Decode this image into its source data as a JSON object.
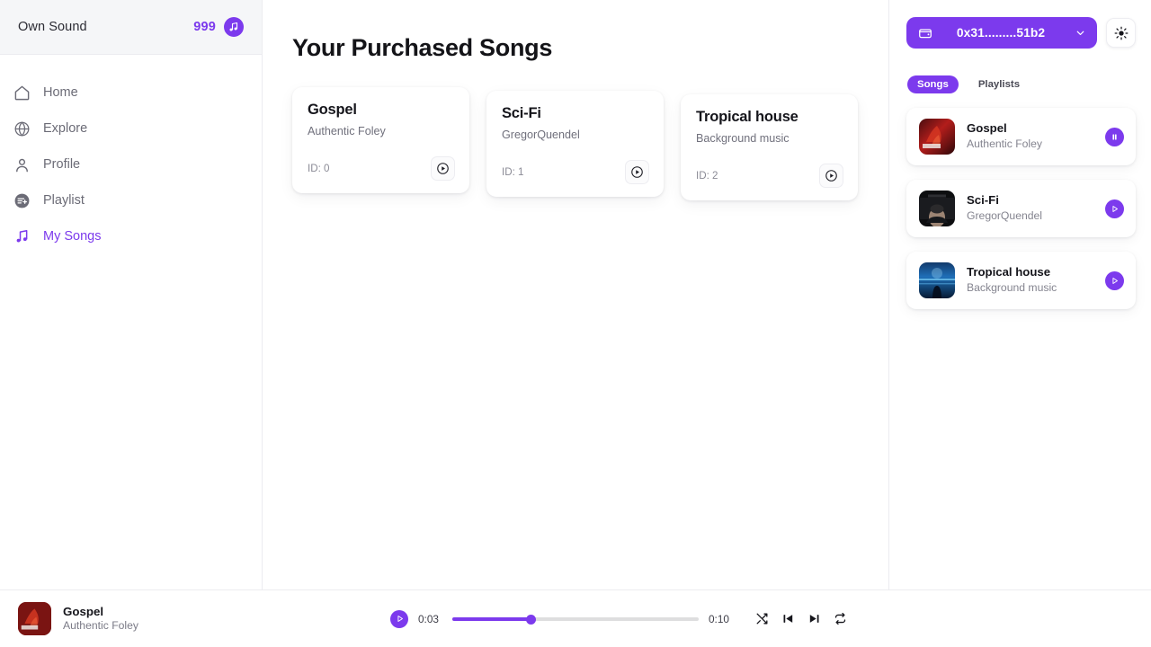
{
  "sidebar": {
    "brand": "Own Sound",
    "credits": "999",
    "credit_icon": "music-note-icon",
    "items": [
      {
        "label": "Home",
        "icon": "home-icon",
        "active": false
      },
      {
        "label": "Explore",
        "icon": "globe-icon",
        "active": false
      },
      {
        "label": "Profile",
        "icon": "user-icon",
        "active": false
      },
      {
        "label": "Playlist",
        "icon": "playlist-add-icon",
        "active": false
      },
      {
        "label": "My Songs",
        "icon": "music-notes-icon",
        "active": true
      }
    ]
  },
  "main": {
    "title": "Your Purchased Songs",
    "cards": [
      {
        "title": "Gospel",
        "artist": "Authentic Foley",
        "id_label": "ID: 0",
        "play_icon": "play-circle-icon"
      },
      {
        "title": "Sci-Fi",
        "artist": "GregorQuendel",
        "id_label": "ID: 1",
        "play_icon": "play-circle-icon"
      },
      {
        "title": "Tropical house",
        "artist": "Background music",
        "id_label": "ID: 2",
        "play_icon": "play-circle-icon"
      }
    ]
  },
  "right": {
    "wallet": {
      "address": "0x31.........51b2",
      "wallet_icon": "wallet-icon",
      "caret_icon": "chevron-down-icon"
    },
    "theme_toggle_icon": "sun-icon",
    "tabs": [
      {
        "label": "Songs",
        "active": true
      },
      {
        "label": "Playlists",
        "active": false
      }
    ],
    "songs": [
      {
        "title": "Gospel",
        "artist": "Authentic Foley",
        "button_icon": "pause-icon",
        "art": "red-abstract"
      },
      {
        "title": "Sci-Fi",
        "artist": "GregorQuendel",
        "button_icon": "play-icon",
        "art": "dark-portrait"
      },
      {
        "title": "Tropical house",
        "artist": "Background music",
        "button_icon": "play-icon",
        "art": "blue-scene"
      }
    ]
  },
  "player": {
    "now_playing": {
      "title": "Gospel",
      "artist": "Authentic Foley",
      "art": "red-abstract"
    },
    "play_icon": "play-icon",
    "current_time": "0:03",
    "total_time": "0:10",
    "progress_percent": 32,
    "controls": [
      {
        "icon": "shuffle-icon"
      },
      {
        "icon": "skip-back-icon"
      },
      {
        "icon": "skip-forward-icon"
      },
      {
        "icon": "repeat-icon"
      }
    ]
  },
  "colors": {
    "accent": "#7c3aed",
    "text_primary": "#15151b",
    "text_muted": "#7b7b87",
    "sidebar_header_bg": "#f5f6f8",
    "border": "#ececf0"
  }
}
